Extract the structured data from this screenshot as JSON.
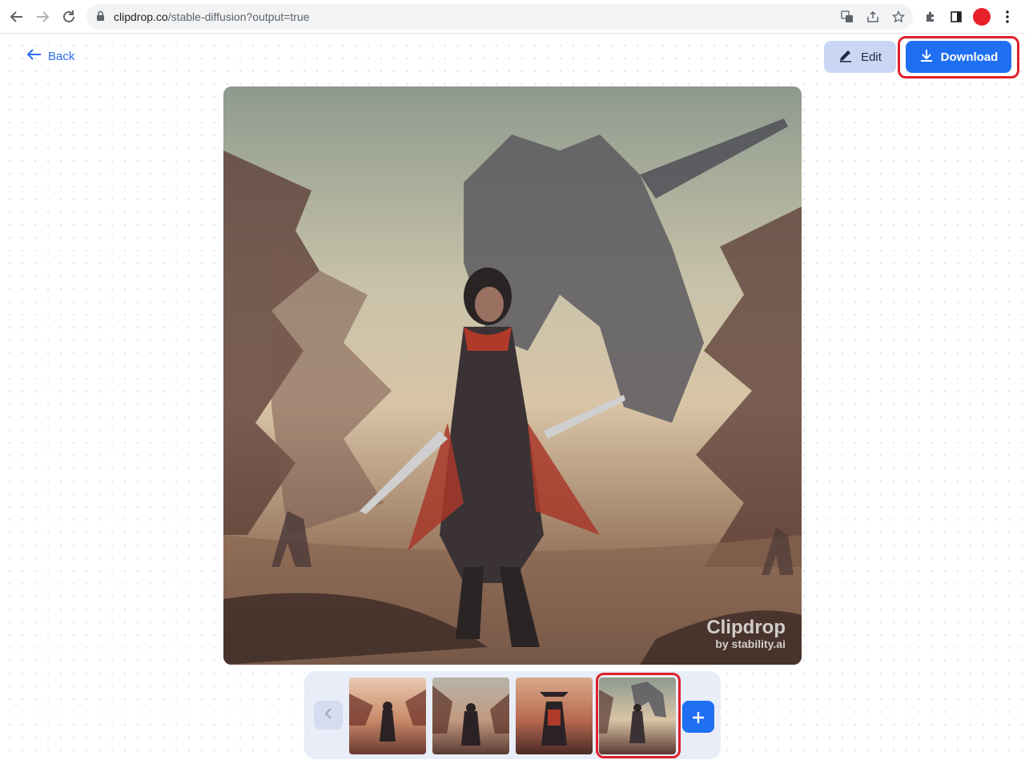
{
  "browser": {
    "url_host": "clipdrop.co",
    "url_path": "/stable-diffusion?output=true",
    "icons": [
      "back-arrow-icon",
      "forward-arrow-icon",
      "reload-icon",
      "lock-icon",
      "translate-icon",
      "share-icon",
      "star-icon",
      "extensions-icon",
      "side-panel-icon",
      "profile-avatar",
      "kebab-menu-icon"
    ]
  },
  "toolbar": {
    "back_label": "Back",
    "edit_label": "Edit",
    "download_label": "Download"
  },
  "main_image": {
    "watermark_main": "Clipdrop",
    "watermark_sub": "by stability.ai"
  },
  "thumbnails": {
    "count": 4,
    "selected_index": 3
  },
  "colors": {
    "accent": "#1f6ff2",
    "highlight": "#e0202a",
    "edit_bg": "#c9d7f5"
  }
}
